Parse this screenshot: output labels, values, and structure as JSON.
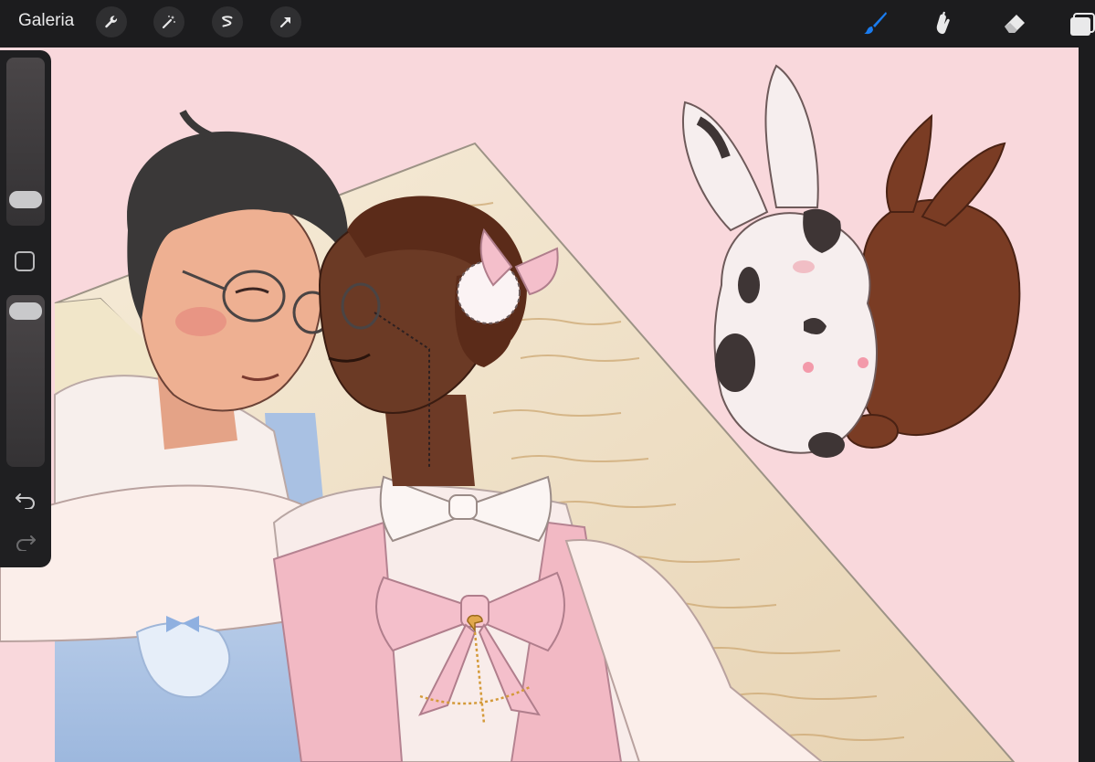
{
  "toolbar": {
    "gallery_label": "Galeria",
    "left_tools": [
      "wrench-icon",
      "magic-wand-icon",
      "selection-icon",
      "transform-arrow-icon"
    ],
    "right_tools": [
      "brush-icon",
      "smudge-icon",
      "eraser-icon",
      "layers-icon"
    ],
    "active_tool": "brush",
    "accent_color": "#1a7cf0"
  },
  "sidebar": {
    "brush_size_level": 0.15,
    "opacity_level": 0.95,
    "icons": [
      "undo-icon",
      "redo-icon"
    ]
  },
  "canvas": {
    "background_color": "#f9d8dc",
    "subject": "artwork"
  }
}
